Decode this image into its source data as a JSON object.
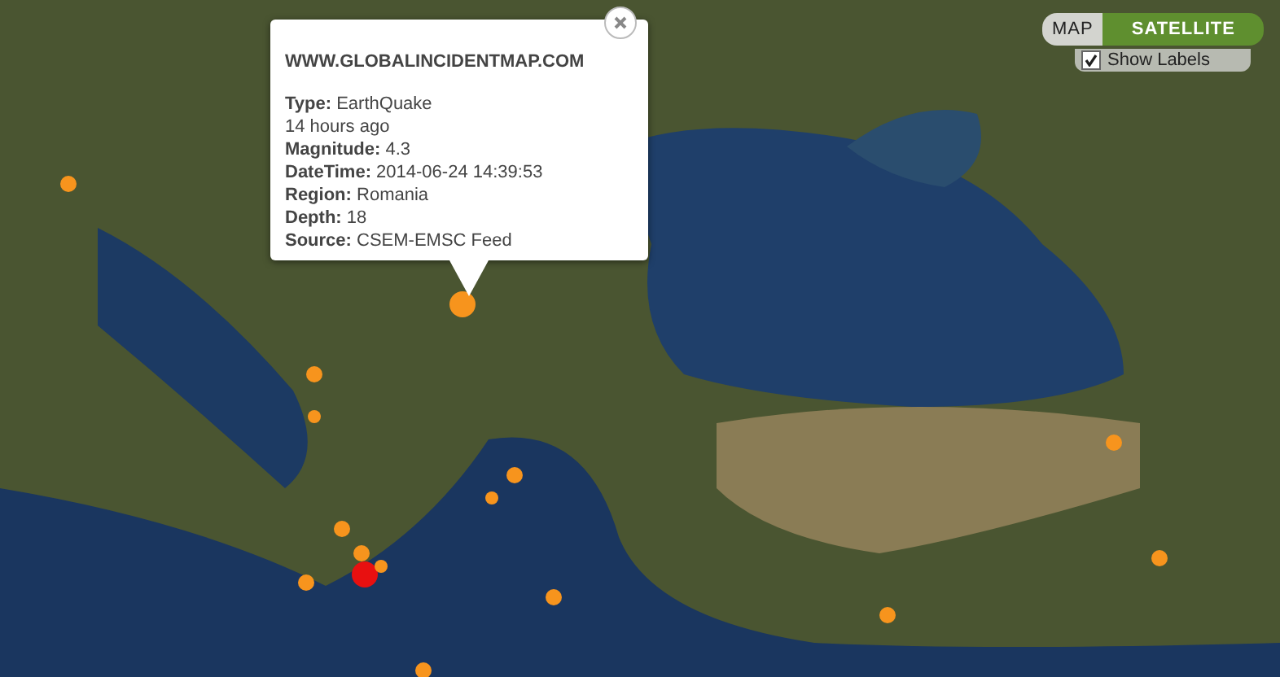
{
  "popup": {
    "site": "WWW.GLOBALINCIDENTMAP.COM",
    "fields": [
      {
        "label": "Type:",
        "value": "EarthQuake"
      },
      {
        "value": "14 hours ago"
      },
      {
        "label": "Magnitude:",
        "value": "4.3"
      },
      {
        "label": "DateTime:",
        "value": "2014-06-24 14:39:53"
      },
      {
        "label": "Region:",
        "value": "Romania"
      },
      {
        "label": "Depth:",
        "value": "18"
      },
      {
        "label": "Source:",
        "value": "CSEM-EMSC Feed"
      }
    ]
  },
  "map_type": {
    "options": [
      {
        "label": "MAP",
        "selected": false
      },
      {
        "label": "SATELLITE",
        "selected": true
      }
    ],
    "show_labels": {
      "label": "Show Labels",
      "checked": true
    }
  },
  "markers": [
    {
      "color": "#f7941d"
    },
    {
      "color": "#f7941d"
    },
    {
      "color": "#f7941d"
    },
    {
      "color": "#f7941d"
    },
    {
      "color": "#f7941d"
    },
    {
      "color": "#f7941d"
    },
    {
      "color": "#f7941d"
    },
    {
      "color": "#f7941d"
    },
    {
      "color": "#e81010"
    },
    {
      "color": "#f7941d"
    },
    {
      "color": "#f7941d"
    },
    {
      "color": "#f7941d"
    },
    {
      "color": "#f7941d"
    },
    {
      "color": "#f7941d"
    },
    {
      "color": "#f7941d"
    },
    {
      "color": "#f7941d"
    }
  ]
}
